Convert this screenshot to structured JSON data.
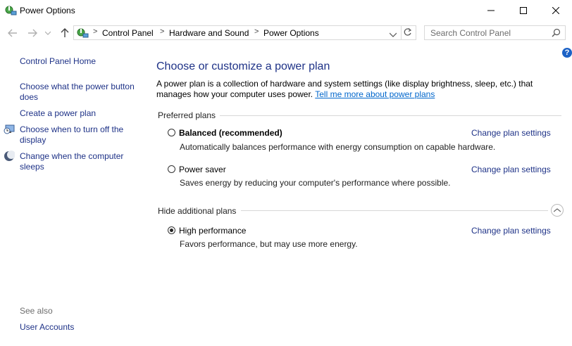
{
  "window": {
    "title": "Power Options"
  },
  "address": {
    "crumbs": [
      "Control Panel",
      "Hardware and Sound",
      "Power Options"
    ],
    "separator": ">"
  },
  "search": {
    "placeholder": "Search Control Panel"
  },
  "help": {
    "label": "?"
  },
  "sidebar": {
    "home": "Control Panel Home",
    "links": [
      "Choose what the power button does",
      "Create a power plan",
      "Choose when to turn off the display",
      "Change when the computer sleeps"
    ],
    "see_also_label": "See also",
    "see_also": [
      "User Accounts"
    ]
  },
  "main": {
    "title": "Choose or customize a power plan",
    "description": "A power plan is a collection of hardware and system settings (like display brightness, sleep, etc.) that manages how your computer uses power.",
    "learn_more": "Tell me more about power plans",
    "preferred_label": "Preferred plans",
    "additional_label": "Hide additional plans",
    "change_label": "Change plan settings",
    "plans": [
      {
        "name": "Balanced (recommended)",
        "description": "Automatically balances performance with energy consumption on capable hardware.",
        "selected": false
      },
      {
        "name": "Power saver",
        "description": "Saves energy by reducing your computer's performance where possible.",
        "selected": false
      },
      {
        "name": "High performance",
        "description": "Favors performance, but may use more energy.",
        "selected": true
      }
    ]
  },
  "colors": {
    "link": "#1e3287",
    "help_link": "#0066cc",
    "accent": "#1c62c6"
  }
}
